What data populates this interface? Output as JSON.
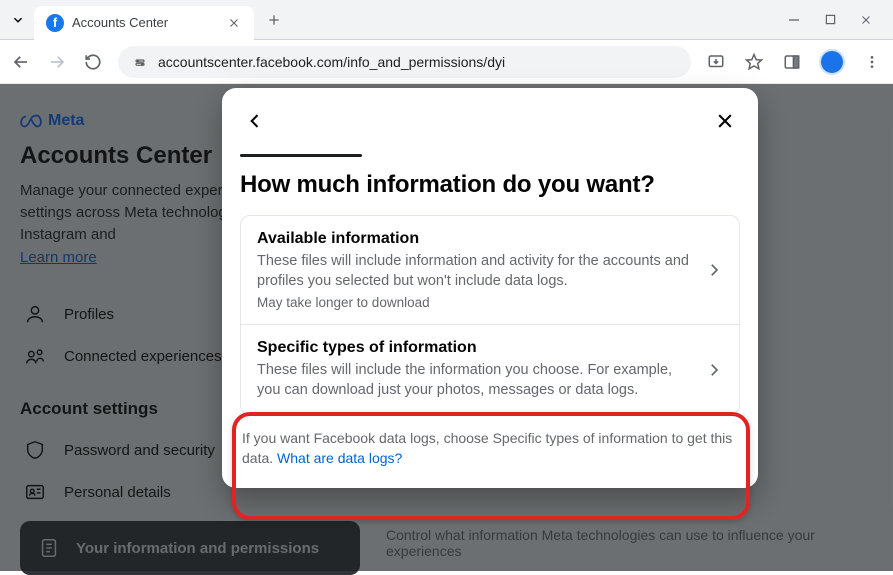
{
  "browser": {
    "tab_title": "Accounts Center",
    "url": "accountscenter.facebook.com/info_and_permissions/dyi"
  },
  "page": {
    "brand": "Meta",
    "title": "Accounts Center",
    "description": "Manage your connected experiences and account settings across Meta technologies like Facebook, Instagram and",
    "learn_more": "Learn more",
    "nav": {
      "profiles": "Profiles",
      "connected": "Connected experiences"
    },
    "section_header": "Account settings",
    "settings": {
      "password": "Password and security",
      "personal": "Personal details",
      "your_info": "Your information and permissions"
    },
    "right_footer": "Control what information Meta technologies can use to influence your experiences"
  },
  "modal": {
    "title": "How much information do you want?",
    "options": [
      {
        "title": "Available information",
        "desc": "These files will include information and activity for the accounts and profiles you selected but won't include data logs.",
        "note": "May take longer to download"
      },
      {
        "title": "Specific types of information",
        "desc": "These files will include the information you choose. For example, you can download just your photos, messages or data logs."
      }
    ],
    "footnote_text": "If you want Facebook data logs, choose Specific types of information to get this data. ",
    "footnote_link": "What are data logs?"
  }
}
